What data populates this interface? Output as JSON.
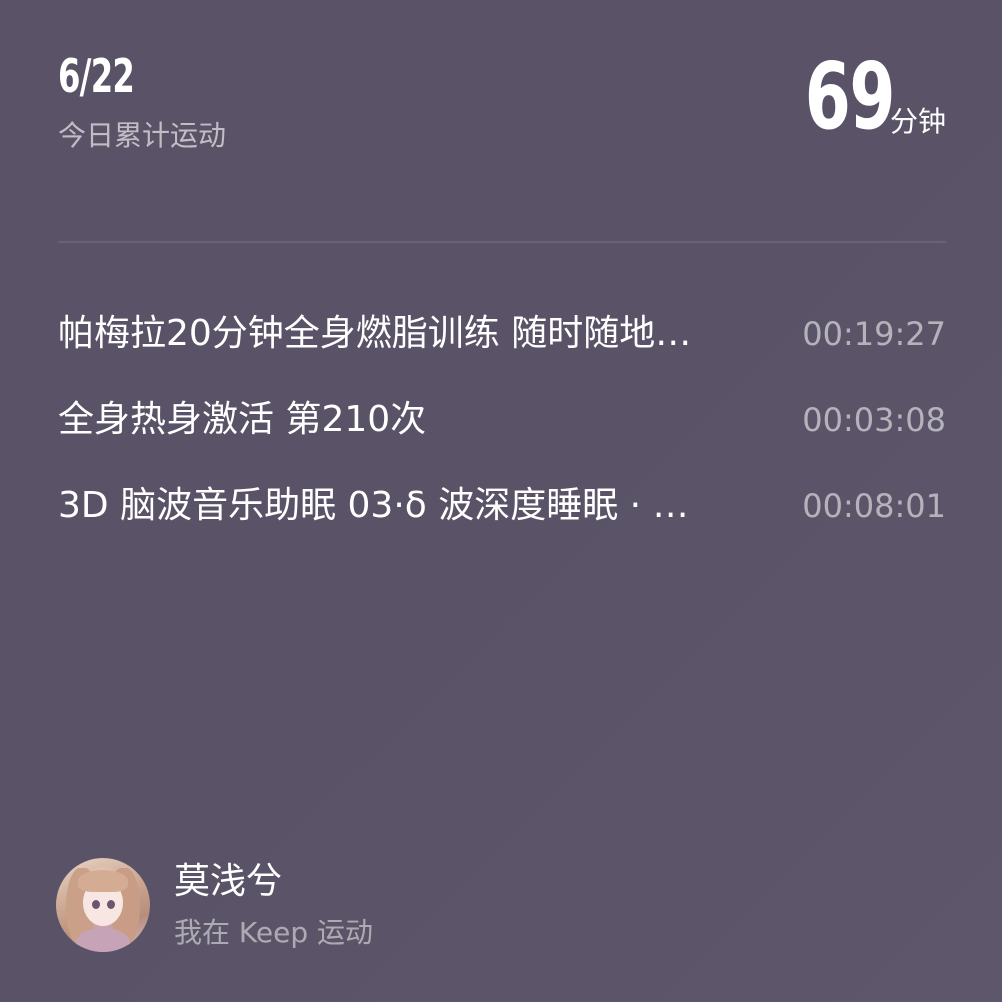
{
  "header": {
    "date": "6/22",
    "subtitle": "今日累计运动",
    "total_value": "69",
    "total_unit": "分钟"
  },
  "activities": [
    {
      "title": "帕梅拉20分钟全身燃脂训练 随时随地…",
      "duration": "00:19:27"
    },
    {
      "title": "全身热身激活 第210次",
      "duration": "00:03:08"
    },
    {
      "title": "3D 脑波音乐助眠 03·δ 波深度睡眠 · …",
      "duration": "00:08:01"
    }
  ],
  "user": {
    "name": "莫浅兮",
    "subtitle": "我在 Keep 运动",
    "avatar_icon": "avatar-illustration"
  },
  "colors": {
    "background": "#5a5367",
    "text_primary": "#ffffff",
    "text_secondary": "#b0a9b7"
  }
}
